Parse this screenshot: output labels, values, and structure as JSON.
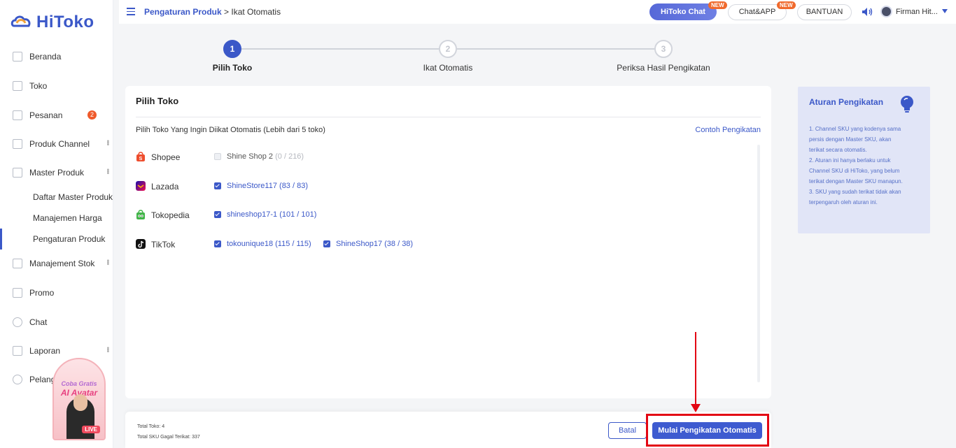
{
  "app": {
    "name": "HiToko"
  },
  "sidebar": {
    "items": [
      {
        "label": "Beranda"
      },
      {
        "label": "Toko"
      },
      {
        "label": "Pesanan",
        "badge": "2"
      },
      {
        "label": "Produk Channel"
      },
      {
        "label": "Master Produk"
      },
      {
        "label": "Manajement Stok"
      },
      {
        "label": "Promo"
      },
      {
        "label": "Chat"
      },
      {
        "label": "Laporan"
      },
      {
        "label": "Pelanggan"
      }
    ],
    "sub_items": [
      {
        "label": "Daftar Master Produk"
      },
      {
        "label": "Manajemen Harga"
      },
      {
        "label": "Pengaturan Produk"
      }
    ],
    "promo": {
      "line1": "Coba Gratis",
      "line2": "AI Avatar",
      "live": "LIVE"
    }
  },
  "header": {
    "breadcrumb_link": "Pengaturan Produk",
    "breadcrumb_sep": " > ",
    "breadcrumb_current": "Ikat Otomatis",
    "hitoko_chat": "HiToko Chat",
    "chat_app": "Chat&APP",
    "new_tag": "NEW",
    "help": "BANTUAN",
    "user": "Firman Hit..."
  },
  "stepper": {
    "steps": [
      {
        "num": "1",
        "label": "Pilih Toko"
      },
      {
        "num": "2",
        "label": "Ikat Otomatis"
      },
      {
        "num": "3",
        "label": "Periksa Hasil Pengikatan"
      }
    ]
  },
  "panel": {
    "title": "Pilih Toko",
    "desc": "Pilih Toko Yang Ingin Diikat Otomatis (Lebih dari 5 toko)",
    "link": "Contoh Pengikatan",
    "channels": [
      {
        "name": "Shopee",
        "shops": [
          {
            "name": "Shine Shop 2",
            "count": "(0 / 216)",
            "checked": false
          }
        ]
      },
      {
        "name": "Lazada",
        "shops": [
          {
            "name": "ShineStore117",
            "count": "(83 / 83)",
            "checked": true
          }
        ]
      },
      {
        "name": "Tokopedia",
        "shops": [
          {
            "name": "shineshop17-1",
            "count": "(101 / 101)",
            "checked": true
          }
        ]
      },
      {
        "name": "TikTok",
        "shops": [
          {
            "name": "tokounique18",
            "count": "(115 / 115)",
            "checked": true
          },
          {
            "name": "ShineShop17",
            "count": "(38 / 38)",
            "checked": true
          }
        ]
      }
    ]
  },
  "info": {
    "title": "Aturan Pengikatan",
    "rules": [
      "1. Channel SKU yang kodenya sama\npersis dengan Master SKU, akan\nterikat secara otomatis.",
      "2. Aturan ini hanya berlaku untuk\nChannel SKU di HiToko, yang belum\nterikat dengan Master SKU manapun.",
      "3. SKU yang sudah terikat tidak akan\nterpengaruh oleh aturan ini."
    ]
  },
  "footer": {
    "total_toko": "Total Toko: 4",
    "total_sku": "Total SKU Gagal Terikat: 337",
    "cancel": "Batal",
    "start": "Mulai Pengikatan Otomatis"
  },
  "colors": {
    "accent": "#3b58c8",
    "annotation": "#e30613",
    "badge": "#ef5a2b"
  }
}
